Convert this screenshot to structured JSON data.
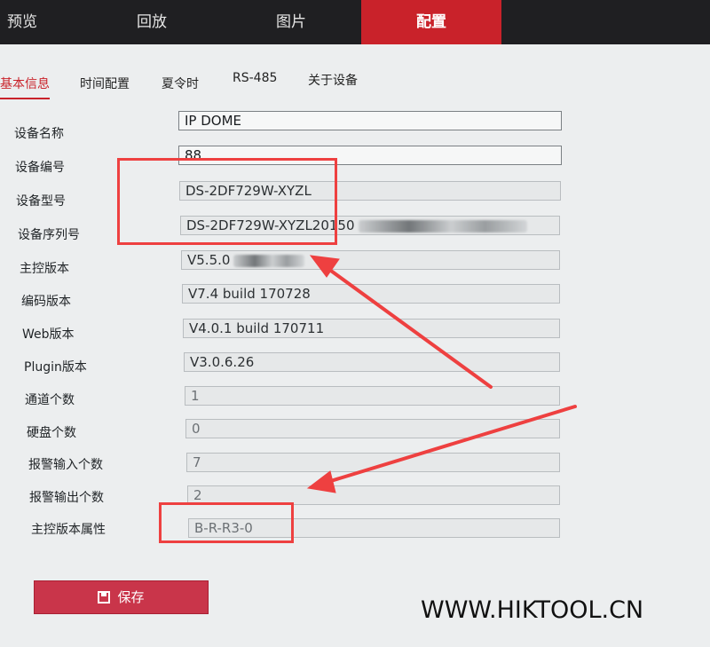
{
  "topnav": {
    "items": [
      {
        "label": "预览",
        "active": false
      },
      {
        "label": "回放",
        "active": false
      },
      {
        "label": "图片",
        "active": false
      },
      {
        "label": "配置",
        "active": true
      }
    ],
    "active_color": "#c9222a"
  },
  "subtabs": [
    "基本信息",
    "时间配置",
    "夏令时",
    "RS-485",
    "关于设备"
  ],
  "fields": [
    {
      "label": "设备名称",
      "value": "IP DOME"
    },
    {
      "label": "设备编号",
      "value": "88"
    },
    {
      "label": "设备型号",
      "value": "DS-2DF729W-XYZL"
    },
    {
      "label": "设备序列号",
      "value": "DS-2DF729W-XYZL20150"
    },
    {
      "label": "主控版本",
      "value": "V5.5.0"
    },
    {
      "label": "编码版本",
      "value": "V7.4 build 170728"
    },
    {
      "label": "Web版本",
      "value": "V4.0.1 build 170711"
    },
    {
      "label": "Plugin版本",
      "value": "V3.0.6.26"
    },
    {
      "label": "通道个数",
      "value": "1"
    },
    {
      "label": "硬盘个数",
      "value": "0"
    },
    {
      "label": "报警输入个数",
      "value": "7"
    },
    {
      "label": "报警输出个数",
      "value": "2"
    },
    {
      "label": "主控版本属性",
      "value": "B-R-R3-0"
    }
  ],
  "save_label": "保存",
  "watermark": "WWW.HIKTOOL.CN",
  "annotation_color": "#ee4040"
}
